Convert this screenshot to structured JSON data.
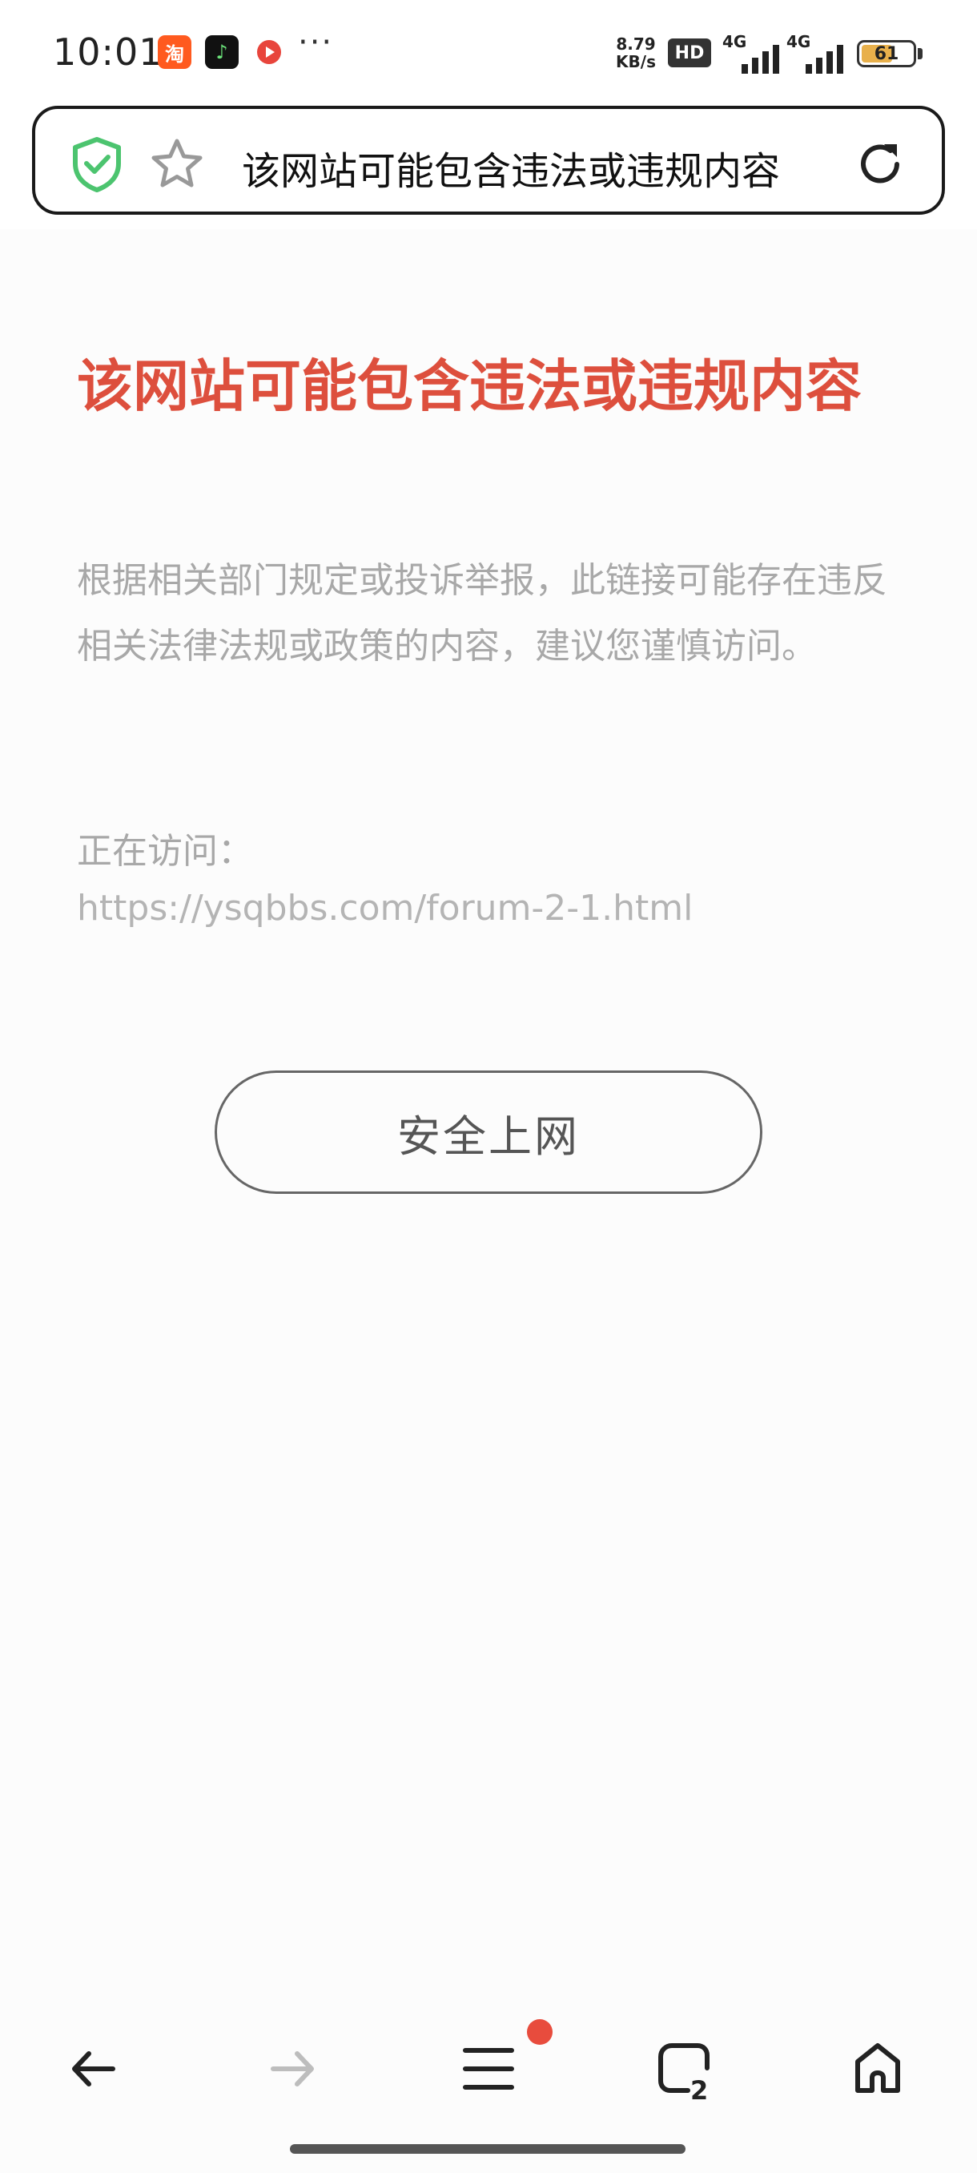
{
  "status_bar": {
    "time": "10:01",
    "apps": [
      "淘",
      "♪",
      "●"
    ],
    "more": "···",
    "net_speed_value": "8.79",
    "net_speed_unit": "KB/s",
    "hd_badge": "HD",
    "signal1_label": "4G",
    "signal2_label": "4G",
    "battery_level": "61",
    "battery_fraction": 0.61,
    "battery_color": "#e8b04b"
  },
  "address_bar": {
    "text": "该网站可能包含违法或违规内容",
    "shield_icon": "shield-check-icon",
    "star_icon": "star-icon",
    "reload_icon": "reload-icon"
  },
  "warning": {
    "title": "该网站可能包含违法或违规内容",
    "description": "根据相关部门规定或投诉举报，此链接可能存在违反相关法律法规或政策的内容，建议您谨慎访问。",
    "visiting_label": "正在访问：",
    "url": "https://ysqbbs.com/forum-2-1.html",
    "safe_button_label": "安全上网",
    "title_color": "#dd4f3d"
  },
  "bottom_nav": {
    "back_icon": "arrow-left-icon",
    "forward_icon": "arrow-right-icon",
    "menu_icon": "menu-icon",
    "tabs_icon": "tabs-icon",
    "home_icon": "home-icon",
    "tab_count": "2",
    "notification_color": "#e84c3d"
  }
}
